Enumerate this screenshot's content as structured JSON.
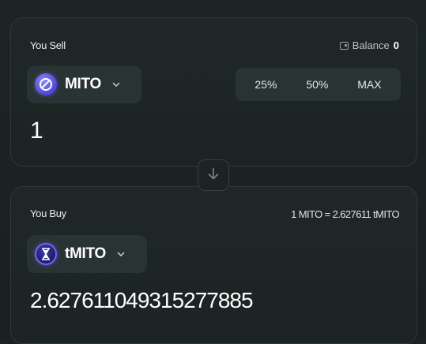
{
  "sell": {
    "label": "You Sell",
    "balance_label": "Balance",
    "balance_value": "0",
    "token": {
      "symbol": "MITO",
      "icon": "mito-token-icon"
    },
    "percent_options": [
      "25%",
      "50%",
      "MAX"
    ],
    "amount": "1"
  },
  "swap": {
    "icon": "arrow-down-icon"
  },
  "buy": {
    "label": "You Buy",
    "rate": "1 MITO = 2.627611 tMITO",
    "token": {
      "symbol": "tMITO",
      "icon": "tmito-token-icon"
    },
    "amount": "2.627611049315277885"
  },
  "colors": {
    "background": "#1b2222",
    "panel": "#1f2727",
    "button": "#2a3333",
    "accent": "#5b56f0"
  }
}
